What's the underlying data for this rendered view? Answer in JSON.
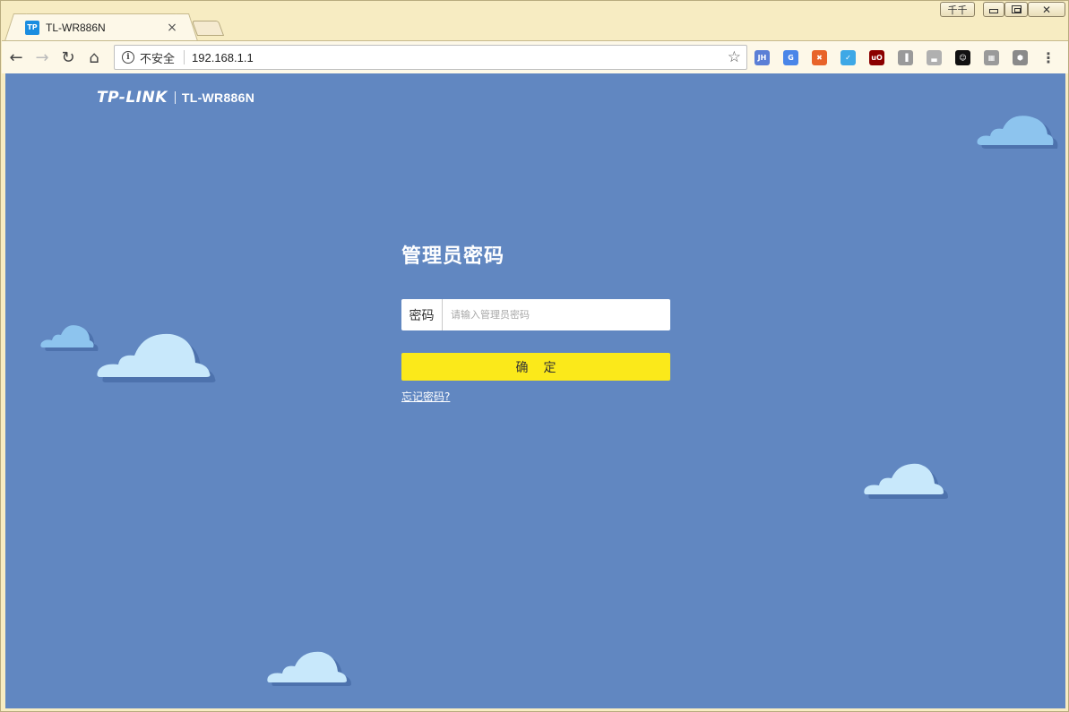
{
  "browser": {
    "tab": {
      "favicon_text": "TP",
      "title": "TL-WR886N",
      "close_glyph": "×"
    },
    "window_buttons": {
      "user_label": "千千",
      "close_glyph": "✕"
    },
    "toolbar": {
      "back_glyph": "←",
      "forward_glyph": "→",
      "reload_glyph": "↻",
      "home_glyph": "⌂",
      "security_label": "不安全",
      "url": "192.168.1.1",
      "star_glyph": "☆",
      "menu_glyph": "⋮"
    },
    "extensions": [
      {
        "name": "jh-extension-icon",
        "text": "JH",
        "color": "#5b7fd6"
      },
      {
        "name": "translate-extension-icon",
        "text": "G",
        "color": "#4a86e8"
      },
      {
        "name": "orange-extension-icon",
        "text": "✖",
        "color": "#e8642a"
      },
      {
        "name": "check-extension-icon",
        "text": "✓",
        "color": "#3ea8e6"
      },
      {
        "name": "ublock-extension-icon",
        "text": "uO",
        "color": "#8b0000"
      },
      {
        "name": "stats-extension-icon",
        "text": "▐",
        "color": "#9a9a9a"
      },
      {
        "name": "chart-extension-icon",
        "text": "▃",
        "color": "#b0b0b0"
      },
      {
        "name": "mask-extension-icon",
        "text": "☺",
        "color": "#111111"
      },
      {
        "name": "cube-extension-icon",
        "text": "▦",
        "color": "#9a9a9a"
      },
      {
        "name": "hex-extension-icon",
        "text": "⬢",
        "color": "#8a8a8a"
      }
    ]
  },
  "page": {
    "brand": {
      "logo": "TP-LINK",
      "model": "TL-WR886N"
    },
    "login": {
      "title": "管理员密码",
      "password_label": "密码",
      "password_value": "",
      "password_placeholder": "请输入管理员密码",
      "confirm_label": "确定",
      "forgot_link": "忘记密码?"
    }
  },
  "colors": {
    "page_background": "#6187c1",
    "button_yellow": "#fbe91a",
    "cloud_fill": "#c8e8fb",
    "cloud_fill_alt": "#8dc4ee",
    "cloud_shadow": "#4d72ad"
  }
}
